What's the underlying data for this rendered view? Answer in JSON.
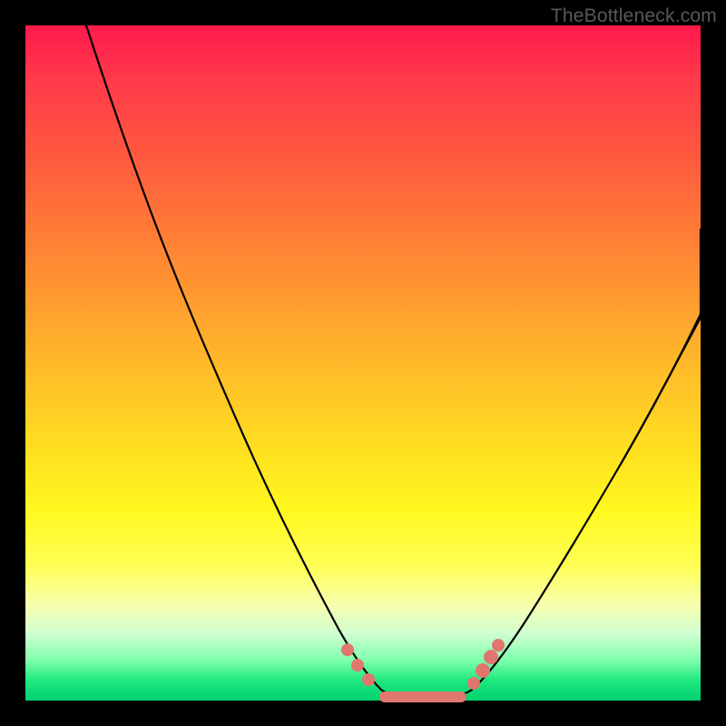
{
  "watermark": "TheBottleneck.com",
  "chart_data": {
    "type": "line",
    "title": "",
    "xlabel": "",
    "ylabel": "",
    "xlim": [
      0,
      100
    ],
    "ylim": [
      0,
      100
    ],
    "grid": false,
    "legend": false,
    "note": "V-shaped bottleneck curve; x is an unlabeled axis (ratio), y is bottleneck percentage. Values are estimated from the plotted pixels because the chart has no tick labels.",
    "series": [
      {
        "name": "left-branch",
        "x": [
          9,
          12,
          15,
          18,
          21,
          24,
          27,
          30,
          33,
          36,
          39,
          42,
          45,
          48,
          50,
          52
        ],
        "y": [
          100,
          90,
          80,
          71,
          62,
          54,
          46,
          39,
          33,
          27,
          21,
          16,
          11,
          6,
          3,
          1
        ]
      },
      {
        "name": "valley",
        "x": [
          52,
          54,
          56,
          58,
          60,
          62,
          64
        ],
        "y": [
          1,
          0.5,
          0.4,
          0.4,
          0.4,
          0.5,
          1
        ]
      },
      {
        "name": "right-branch",
        "x": [
          64,
          67,
          70,
          73,
          76,
          79,
          82,
          85,
          88,
          91,
          94,
          97,
          100
        ],
        "y": [
          1,
          4,
          8,
          13,
          18,
          23,
          29,
          35,
          41,
          48,
          55,
          62,
          69
        ]
      }
    ],
    "markers": {
      "name": "highlighted-range",
      "color": "#e1766f",
      "points_xy": [
        [
          48,
          7
        ],
        [
          49.5,
          5
        ],
        [
          51,
          2.8
        ],
        [
          53,
          1.2
        ],
        [
          54.5,
          0.8
        ],
        [
          56,
          0.6
        ],
        [
          58,
          0.6
        ],
        [
          60,
          0.6
        ],
        [
          61.5,
          0.8
        ],
        [
          63,
          1.2
        ],
        [
          64.5,
          2
        ],
        [
          65.5,
          3.2
        ],
        [
          67,
          5
        ],
        [
          68,
          6.5
        ]
      ]
    }
  }
}
